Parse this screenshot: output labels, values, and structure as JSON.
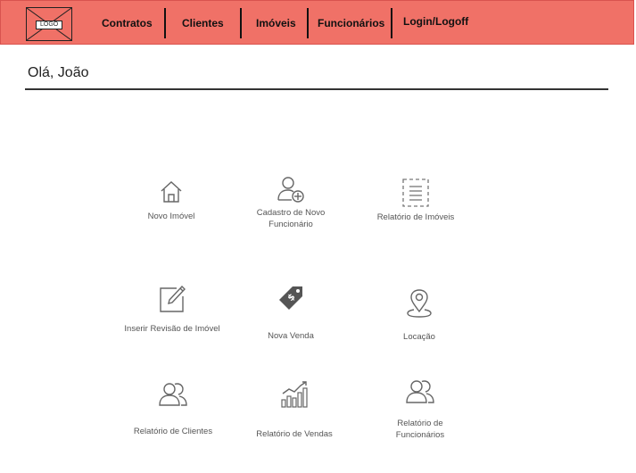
{
  "header": {
    "logo": "LOGO",
    "nav": [
      "Contratos",
      "Clientes",
      "Imóveis",
      "Funcionários",
      "Login/Logoff"
    ]
  },
  "greeting": "Olá, João",
  "tiles": [
    {
      "label": "Novo Imóvel",
      "icon": "house-icon"
    },
    {
      "label": "Cadastro de Novo Funcionário",
      "icon": "add-user-icon"
    },
    {
      "label": "Relatório de Imóveis",
      "icon": "document-list-icon"
    },
    {
      "label": "Inserir Revisão de Imóvel",
      "icon": "edit-icon"
    },
    {
      "label": "Nova Venda",
      "icon": "price-tag-icon"
    },
    {
      "label": "Locação",
      "icon": "location-pin-icon"
    },
    {
      "label": "Relatório de Clientes",
      "icon": "users-icon"
    },
    {
      "label": "Relatório de Vendas",
      "icon": "bar-chart-icon"
    },
    {
      "label": "Relatório de Funcionários",
      "icon": "users-icon"
    }
  ]
}
